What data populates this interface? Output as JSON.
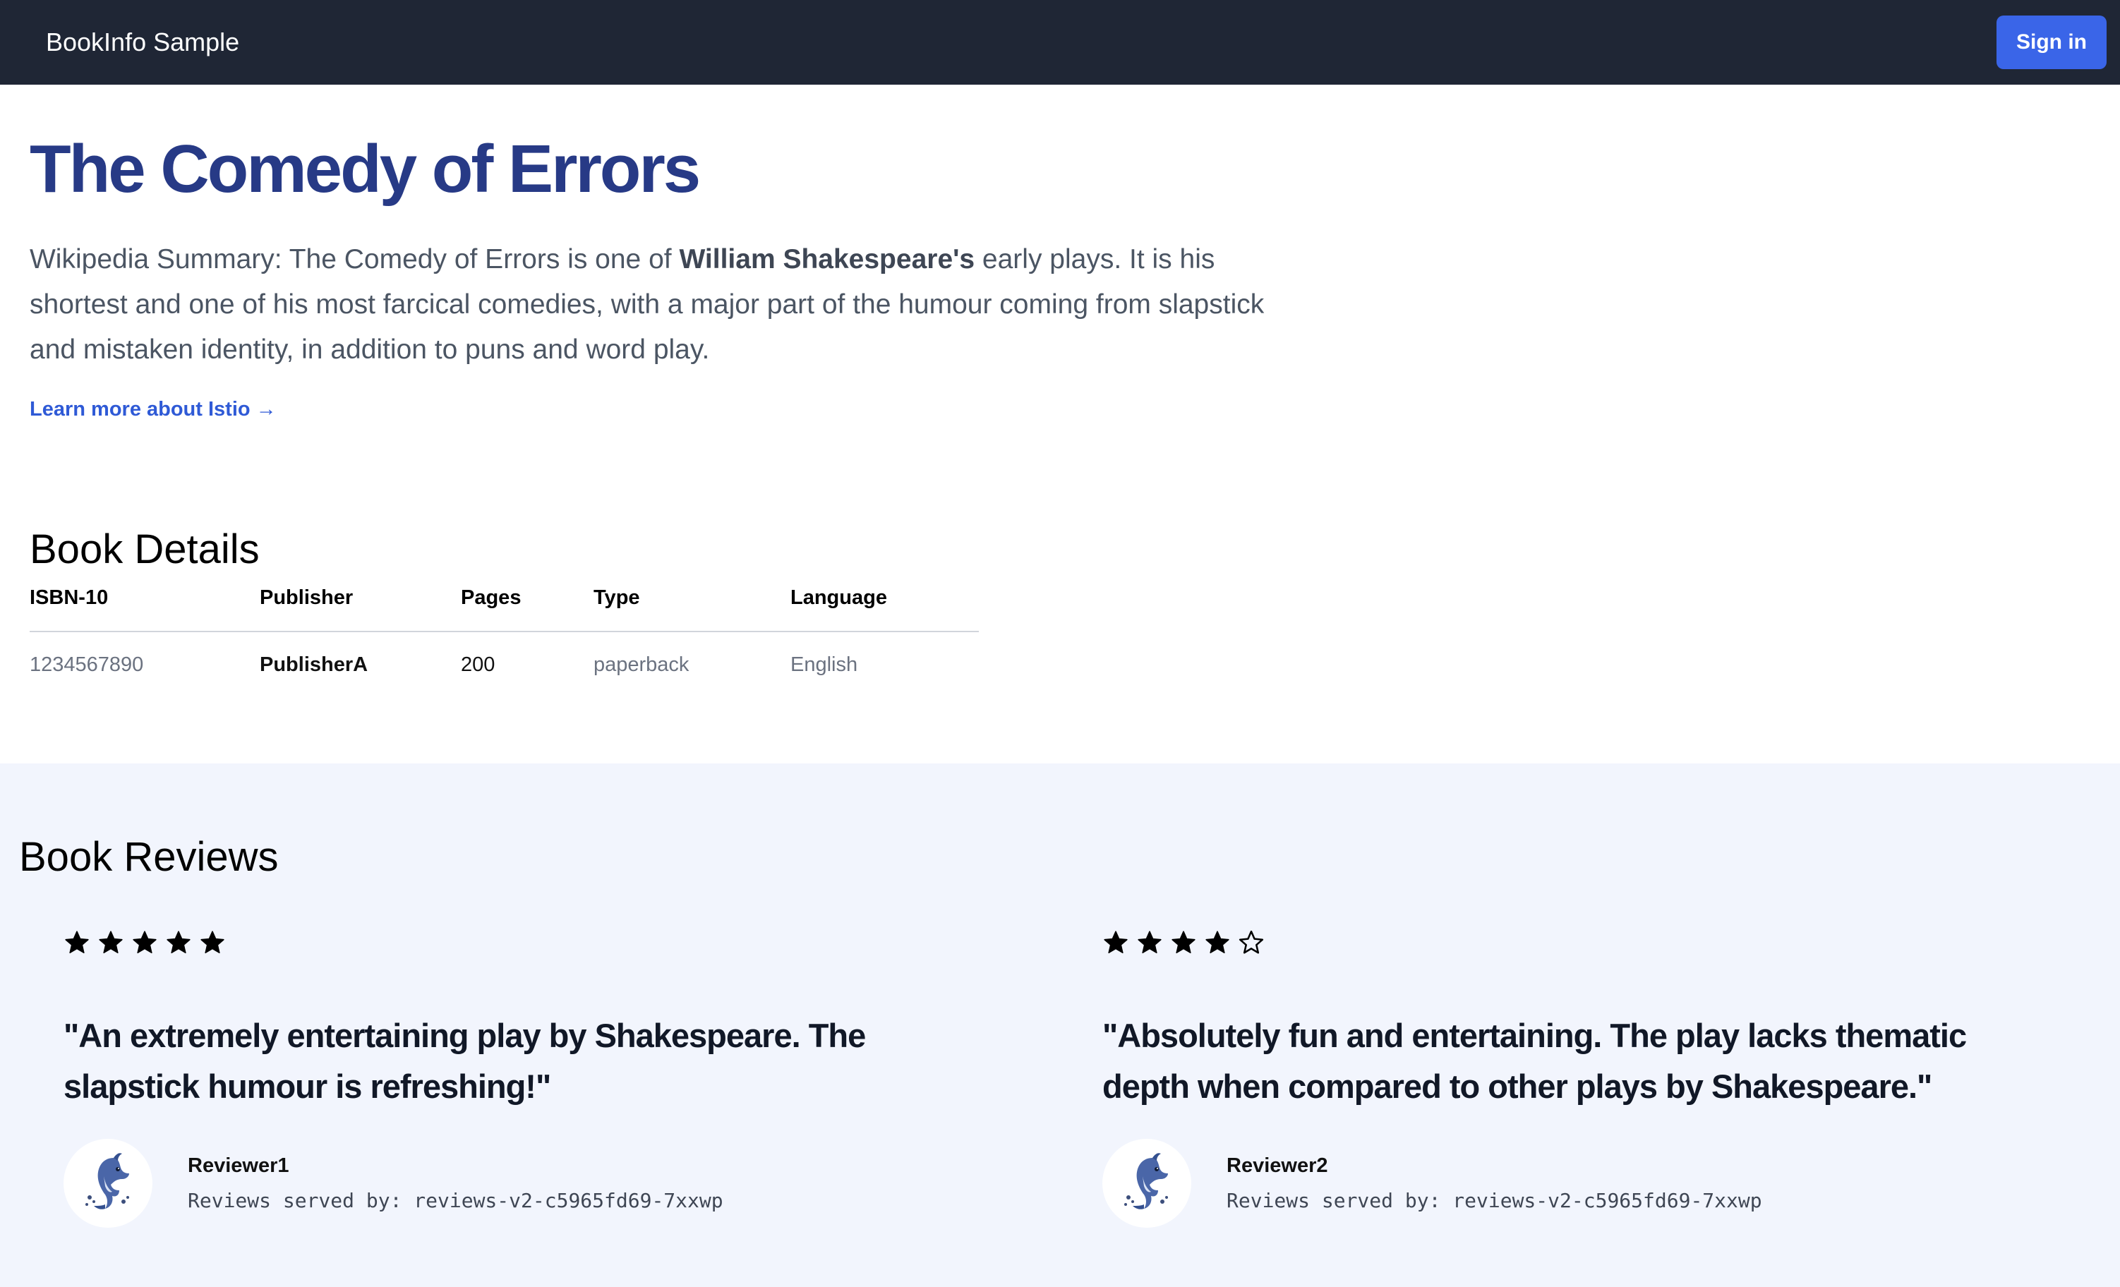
{
  "navbar": {
    "brand": "BookInfo Sample",
    "signin_label": "Sign in"
  },
  "book": {
    "title": "The Comedy of Errors",
    "summary_prefix": "Wikipedia Summary: The Comedy of Errors is one of ",
    "summary_author": "William Shakespeare's",
    "summary_suffix": " early plays. It is his shortest and one of his most farcical comedies, with a major part of the humour coming from slapstick and mistaken identity, in addition to puns and word play.",
    "learn_more": "Learn more about Istio →"
  },
  "details": {
    "title": "Book Details",
    "headers": [
      "ISBN-10",
      "Publisher",
      "Pages",
      "Type",
      "Language"
    ],
    "row": [
      "1234567890",
      "PublisherA",
      "200",
      "paperback",
      "English"
    ]
  },
  "reviews": {
    "title": "Book Reviews",
    "items": [
      {
        "stars": 5,
        "quote": "\"An extremely entertaining play by Shakespeare. The slapstick humour is refreshing!\"",
        "reviewer": "Reviewer1",
        "served_by": "Reviews served by: reviews-v2-c5965fd69-7xxwp",
        "avatar_icon": "dolphin-icon"
      },
      {
        "stars": 4,
        "quote": "\"Absolutely fun and entertaining. The play lacks thematic depth when compared to other plays by Shakespeare.\"",
        "reviewer": "Reviewer2",
        "served_by": "Reviews served by: reviews-v2-c5965fd69-7xxwp",
        "avatar_icon": "dolphin-icon"
      }
    ],
    "max_stars": 5
  },
  "colors": {
    "navbar_bg": "#1f2635",
    "signin_bg": "#3a65e8",
    "title": "#273a86",
    "link": "#2f5ad6",
    "reviews_bg": "#f2f5fd"
  }
}
